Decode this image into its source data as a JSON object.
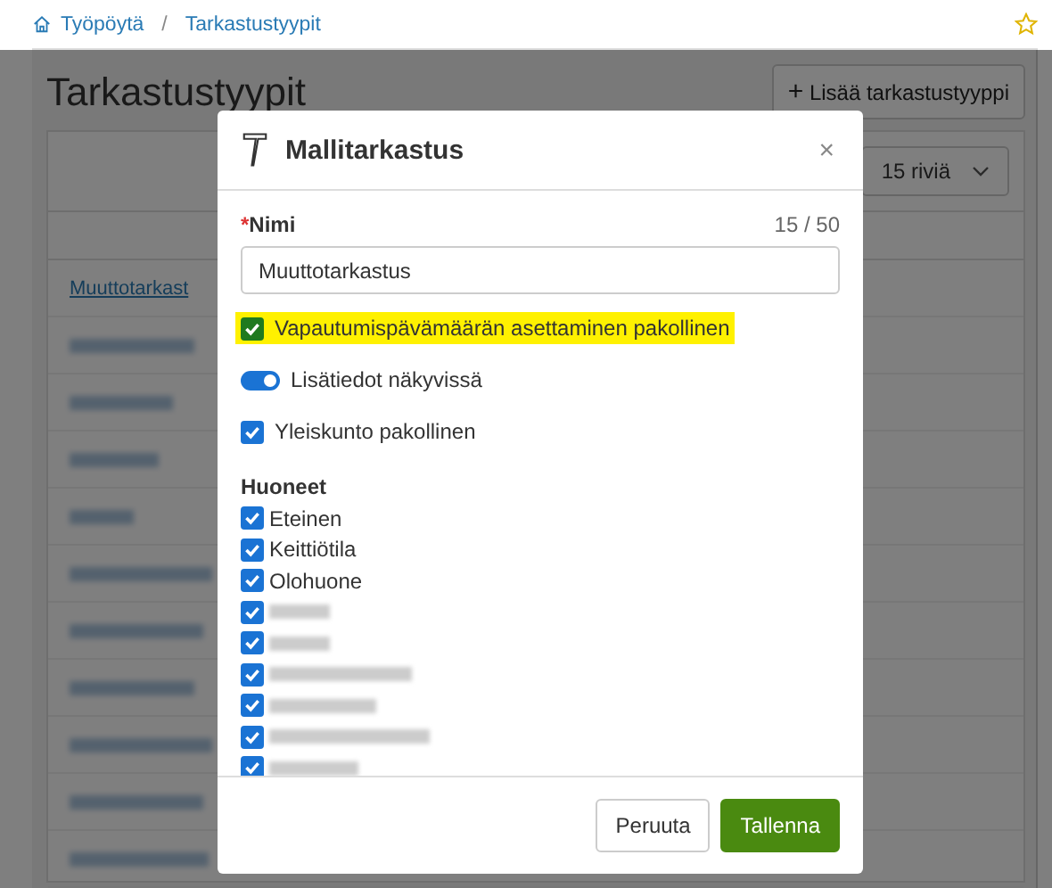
{
  "breadcrumb": [
    {
      "label": "Työpöytä",
      "kind": "home"
    },
    {
      "label": "Tarkastustyypit"
    }
  ],
  "separator": "/",
  "page": {
    "title": "Tarkastustyypit",
    "add_icon": "+",
    "add_button": "Lisää tarkastustyyppi",
    "rows_select": "15 riviä",
    "first_row_link": "Muuttotarkast"
  },
  "dialog": {
    "title": "Mallitarkastus",
    "close": "×",
    "name_field": {
      "label": "Nimi",
      "required": true,
      "required_mark": "*",
      "counter": "15 / 50",
      "value": "Muuttotarkastus"
    },
    "options": [
      {
        "kind": "checkbox",
        "label": "Vapautumispävämäärän asettaminen pakollinen",
        "checked": true,
        "highlighted": true
      },
      {
        "kind": "toggle",
        "label": "Lisätiedot näkyvissä",
        "on": true,
        "highlighted": false
      },
      {
        "kind": "checkbox",
        "label": "Yleiskunto pakollinen",
        "checked": true,
        "highlighted": false
      }
    ],
    "rooms": {
      "title": "Huoneet",
      "items": [
        {
          "kind": "text",
          "label": "Eteinen",
          "checked": true
        },
        {
          "kind": "text",
          "label": "Keittiötila",
          "checked": true
        },
        {
          "kind": "text",
          "label": "Olohuone",
          "checked": true
        },
        {
          "kind": "blurred",
          "checked": true
        },
        {
          "kind": "blurred",
          "checked": true
        },
        {
          "kind": "blurred",
          "checked": true
        },
        {
          "kind": "blurred",
          "checked": true
        },
        {
          "kind": "blurred",
          "checked": true
        },
        {
          "kind": "blurred",
          "checked": true
        }
      ]
    },
    "buttons": [
      {
        "label": "Peruuta",
        "kind": "secondary"
      },
      {
        "label": "Tallenna",
        "kind": "primary"
      }
    ]
  }
}
